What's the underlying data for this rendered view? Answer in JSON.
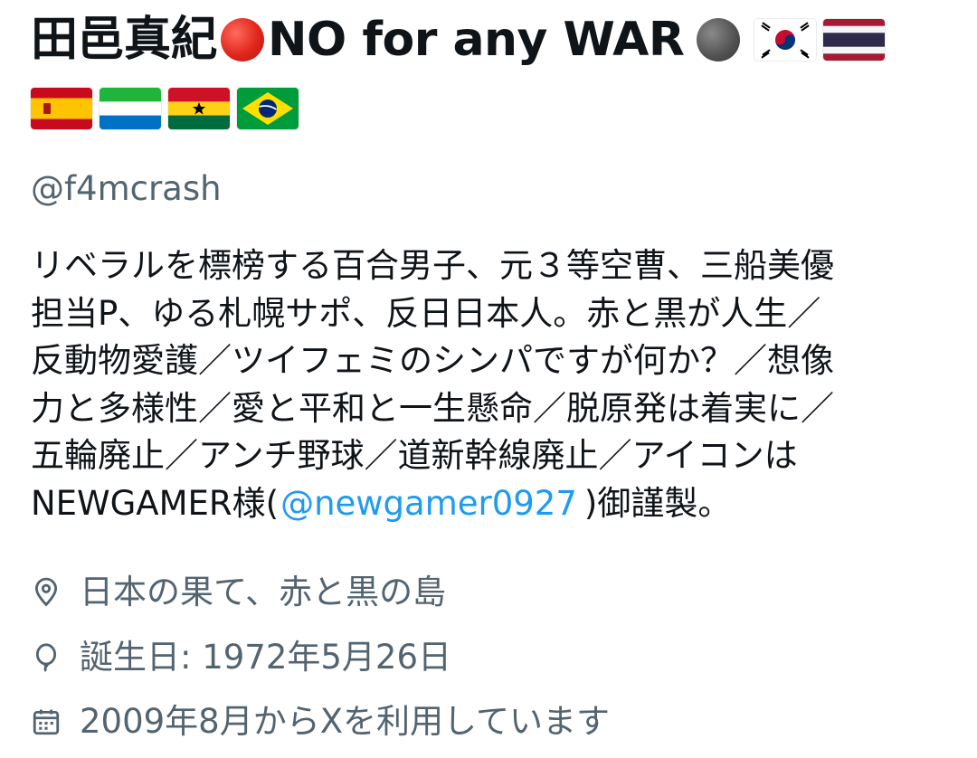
{
  "profile": {
    "name_text": "田邑真紀",
    "name_slogan": "NO for any WAR",
    "flags_line1": [
      "south-korea-flag",
      "thailand-flag"
    ],
    "flags_line2": [
      "spain-flag",
      "sierra-leone-flag",
      "ghana-flag",
      "brazil-flag"
    ],
    "handle": "@f4mcrash",
    "bio_lines": [
      "リベラルを標榜する百合男子、元３等空曹、三船美優",
      "担当P、ゆる札幌サポ、反日日本人。赤と黒が人生／",
      "反動物愛護／ツイフェミのシンパですが何か？／想像",
      "力と多様性／愛と平和と一生懸命／脱原発は着実に／",
      "五輪廃止／アンチ野球／道新幹線廃止／アイコンは"
    ],
    "bio_last_prefix": "NEWGAMER様(",
    "bio_mention": "@newgamer0927",
    "bio_last_suffix": ")御謹製。",
    "location": "日本の果て、赤と黒の島",
    "birthday": "誕生日: 1972年5月26日",
    "joined": "2009年8月からXを利用しています"
  },
  "icons": {
    "location": "location-pin-icon",
    "birthday": "balloon-icon",
    "joined": "calendar-icon"
  },
  "colors": {
    "text": "#0f1419",
    "secondary": "#536471",
    "link": "#1d9bf0"
  }
}
